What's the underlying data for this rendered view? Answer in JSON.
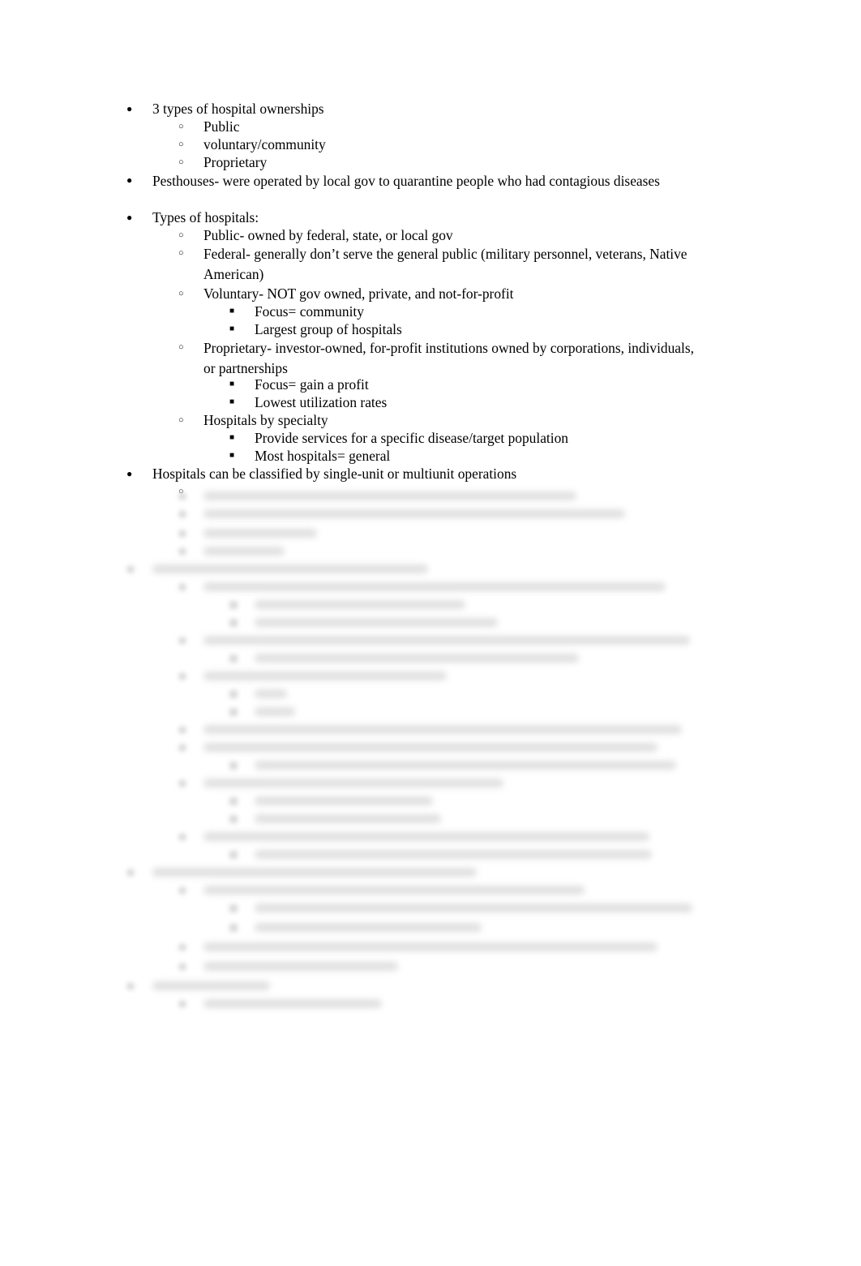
{
  "document": {
    "outline": [
      {
        "level": 1,
        "bullet": "●",
        "text": "3 types of hospital ownerships"
      },
      {
        "level": 2,
        "bullet": "○",
        "text": "Public"
      },
      {
        "level": 2,
        "bullet": "○",
        "text": "voluntary/community"
      },
      {
        "level": 2,
        "bullet": "○",
        "text": "Proprietary"
      },
      {
        "level": 1,
        "bullet": "●",
        "text": "Pesthouses- were operated by local gov to quarantine people who had contagious diseases"
      },
      {
        "level": 1,
        "bullet": "●",
        "text": "Types of hospitals:"
      },
      {
        "level": 2,
        "bullet": "○",
        "text": "Public- owned by federal, state, or local gov"
      },
      {
        "level": 2,
        "bullet": "○",
        "text": "Federal- generally don’t serve the general public (military personnel, veterans, Native American)"
      },
      {
        "level": 2,
        "bullet": "○",
        "text": "Voluntary- NOT gov owned, private, and not-for-profit"
      },
      {
        "level": 3,
        "bullet": "■",
        "text": "Focus= community"
      },
      {
        "level": 3,
        "bullet": "■",
        "text": "Largest group of hospitals"
      },
      {
        "level": 2,
        "bullet": "○",
        "text": "Proprietary- investor-owned, for-profit institutions owned by corporations, individuals, or partnerships"
      },
      {
        "level": 3,
        "bullet": "■",
        "text": "Focus= gain a profit"
      },
      {
        "level": 3,
        "bullet": "■",
        "text": "Lowest utilization rates"
      },
      {
        "level": 2,
        "bullet": "○",
        "text": "Hospitals by specialty"
      },
      {
        "level": 3,
        "bullet": "■",
        "text": "Provide services for a specific disease/target population"
      },
      {
        "level": 3,
        "bullet": "■",
        "text": "Most hospitals= general"
      },
      {
        "level": 1,
        "bullet": "●",
        "text": "Hospitals can be classified by single-unit or multiunit operations"
      },
      {
        "level": 2,
        "bullet": "○",
        "text": ""
      }
    ],
    "blurred_preview": true
  }
}
